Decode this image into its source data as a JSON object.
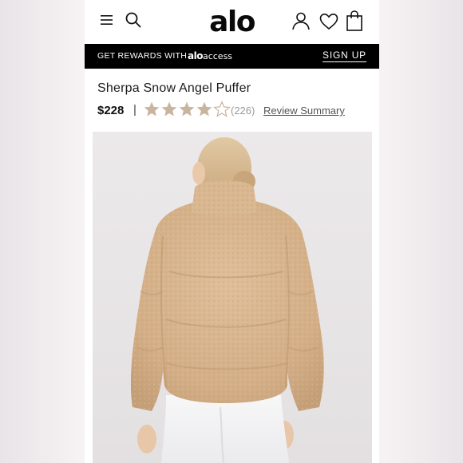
{
  "header": {
    "logo": "alo",
    "icons": [
      "menu-icon",
      "search-icon",
      "account-icon",
      "heart-icon",
      "shopping-bag-icon"
    ]
  },
  "rewards": {
    "text": "GET REWARDS WITH",
    "brand": "alo",
    "brand_suffix": "access",
    "cta": "SIGN UP"
  },
  "product": {
    "title": "Sherpa Snow Angel Puffer",
    "price": "$228",
    "separator": "|",
    "rating": 4,
    "rating_max": 5,
    "review_count": "(226)",
    "review_link": "Review Summary",
    "image_alt": "model wearing sherpa puffer jacket, back view"
  },
  "colors": {
    "star_filled": "#c7b299",
    "star_empty": "#c7b299",
    "jacket": "#d7b48e",
    "rewards_bg": "#000000"
  }
}
